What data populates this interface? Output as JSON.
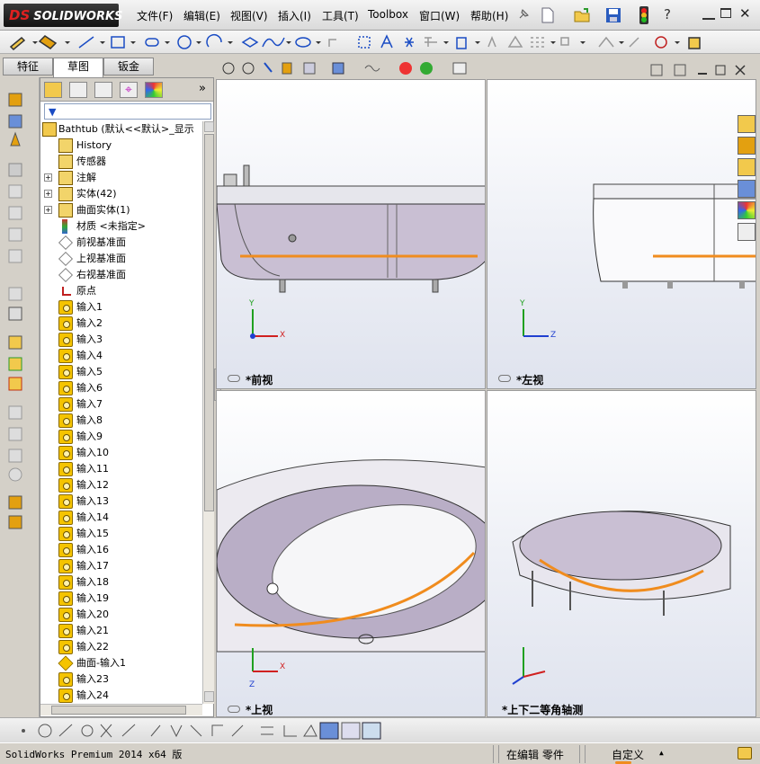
{
  "app": {
    "brand": "SOLIDWORKS",
    "brand_prefix": "DS"
  },
  "menu": [
    "文件(F)",
    "编辑(E)",
    "视图(V)",
    "插入(I)",
    "工具(T)",
    "Toolbox",
    "窗口(W)",
    "帮助(H)"
  ],
  "panel_tabs": [
    "特征",
    "草图",
    "钣金"
  ],
  "active_panel_tab": "草图",
  "tree": {
    "root": "Bathtub  (默认<<默认>_显示",
    "items": [
      {
        "label": "History",
        "icon": "history-icon",
        "expand": false
      },
      {
        "label": "传感器",
        "icon": "sensor-icon",
        "expand": false
      },
      {
        "label": "注解",
        "icon": "annotation-icon",
        "expand": true
      },
      {
        "label": "实体(42)",
        "icon": "solid-bodies-icon",
        "expand": true
      },
      {
        "label": "曲面实体(1)",
        "icon": "surface-bodies-icon",
        "expand": true
      },
      {
        "label": "材质 <未指定>",
        "icon": "material-icon",
        "expand": false
      },
      {
        "label": "前视基准面",
        "icon": "plane-icon",
        "expand": false
      },
      {
        "label": "上视基准面",
        "icon": "plane-icon",
        "expand": false
      },
      {
        "label": "右视基准面",
        "icon": "plane-icon",
        "expand": false
      },
      {
        "label": "原点",
        "icon": "origin-icon",
        "expand": false
      },
      {
        "label": "输入1",
        "icon": "import-icon",
        "expand": false
      },
      {
        "label": "输入2",
        "icon": "import-icon",
        "expand": false
      },
      {
        "label": "输入3",
        "icon": "import-icon",
        "expand": false
      },
      {
        "label": "输入4",
        "icon": "import-icon",
        "expand": false
      },
      {
        "label": "输入5",
        "icon": "import-icon",
        "expand": false
      },
      {
        "label": "输入6",
        "icon": "import-icon",
        "expand": false
      },
      {
        "label": "输入7",
        "icon": "import-icon",
        "expand": false
      },
      {
        "label": "输入8",
        "icon": "import-icon",
        "expand": false
      },
      {
        "label": "输入9",
        "icon": "import-icon",
        "expand": false
      },
      {
        "label": "输入10",
        "icon": "import-icon",
        "expand": false
      },
      {
        "label": "输入11",
        "icon": "import-icon",
        "expand": false
      },
      {
        "label": "输入12",
        "icon": "import-icon",
        "expand": false
      },
      {
        "label": "输入13",
        "icon": "import-icon",
        "expand": false
      },
      {
        "label": "输入14",
        "icon": "import-icon",
        "expand": false
      },
      {
        "label": "输入15",
        "icon": "import-icon",
        "expand": false
      },
      {
        "label": "输入16",
        "icon": "import-icon",
        "expand": false
      },
      {
        "label": "输入17",
        "icon": "import-icon",
        "expand": false
      },
      {
        "label": "输入18",
        "icon": "import-icon",
        "expand": false
      },
      {
        "label": "输入19",
        "icon": "import-icon",
        "expand": false
      },
      {
        "label": "输入20",
        "icon": "import-icon",
        "expand": false
      },
      {
        "label": "输入21",
        "icon": "import-icon",
        "expand": false
      },
      {
        "label": "输入22",
        "icon": "import-icon",
        "expand": false
      },
      {
        "label": "曲面-输入1",
        "icon": "surface-import-icon",
        "expand": false
      },
      {
        "label": "输入23",
        "icon": "import-icon",
        "expand": false
      },
      {
        "label": "输入24",
        "icon": "import-icon",
        "expand": false
      }
    ]
  },
  "viewports": {
    "front": "*前视",
    "left": "*左视",
    "top": "*上视",
    "iso": "*上下二等角轴测"
  },
  "axes": {
    "x": "X",
    "y": "Y",
    "z": "Z"
  },
  "status": {
    "version": "SolidWorks Premium 2014 x64 版",
    "mode": "在编辑 零件",
    "custom": "自定义"
  },
  "colors": {
    "accent_orange": "#f08c1e",
    "axis_x": "#d02020",
    "axis_y": "#20a020",
    "axis_z": "#2040d0"
  }
}
